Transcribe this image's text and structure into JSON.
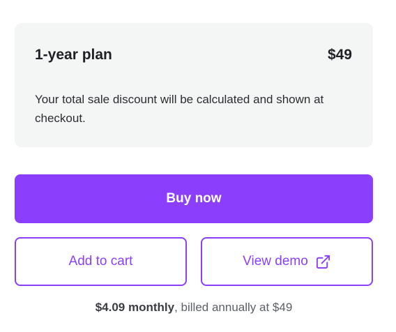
{
  "plan": {
    "name": "1-year plan",
    "price": "$49",
    "note": "Your total sale discount will be calculated and shown at checkout."
  },
  "actions": {
    "buy_label": "Buy now",
    "add_to_cart_label": "Add to cart",
    "view_demo_label": "View demo",
    "view_demo_icon": "external-link-icon"
  },
  "billing": {
    "monthly_price": "$4.09 monthly",
    "suffix": ", billed annually at $49"
  },
  "colors": {
    "accent": "#8b3ffc",
    "card_background": "#f4f5f5"
  }
}
